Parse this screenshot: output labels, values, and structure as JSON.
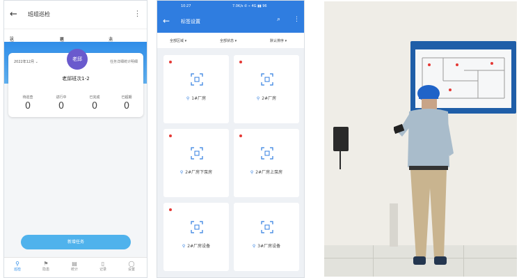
{
  "phone1": {
    "back_glyph": "←",
    "title": "班组巡检",
    "more_glyph": "⋮",
    "menu": [
      {
        "icon": "list-icon",
        "glyph": "☷",
        "label": "巡检地址"
      },
      {
        "icon": "calendar-icon",
        "glyph": "▦",
        "label": "巡检任务"
      },
      {
        "icon": "bell-icon",
        "glyph": "♫",
        "label": "消息提醒"
      }
    ],
    "card": {
      "avatar": "老邱",
      "date": "2022年12月 ⌄",
      "right_text": "任务详细统计明细",
      "team": "老邱班次1-2",
      "stats": [
        {
          "label": "待巡查",
          "value": "0"
        },
        {
          "label": "进行中",
          "value": "0"
        },
        {
          "label": "已完成",
          "value": "0"
        },
        {
          "label": "已超期",
          "value": "0"
        }
      ]
    },
    "button": "新增任务",
    "tabs": [
      {
        "icon": "location-icon",
        "glyph": "⚲",
        "label": "巡检"
      },
      {
        "icon": "flag-icon",
        "glyph": "⚑",
        "label": "隐患"
      },
      {
        "icon": "chart-icon",
        "glyph": "▤",
        "label": "统计"
      },
      {
        "icon": "file-icon",
        "glyph": "▯",
        "label": "记录"
      },
      {
        "icon": "user-icon",
        "glyph": "◯",
        "label": "设置"
      }
    ]
  },
  "phone2": {
    "status_left": "10:27",
    "status_right": "7.0K/s ✆ ⌁ 4G ▮▮ 96",
    "back_glyph": "←",
    "title": "标签设置",
    "search_glyph": "⌕",
    "more_glyph": "⋮",
    "filters": [
      "全部区域 ▾",
      "全部状态 ▾",
      "默认排序 ▾"
    ],
    "cards": [
      {
        "location": "1#厂房"
      },
      {
        "location": "2#厂房"
      },
      {
        "location": "2#厂房下泵房"
      },
      {
        "location": "2#厂房上泵房"
      },
      {
        "location": "2#厂房设备"
      },
      {
        "location": "3#厂房设备"
      }
    ]
  },
  "photo": {
    "description_colors": {
      "helmet": "#1f63c8",
      "shirt": "#a9bccb",
      "trousers": "#c9b48f",
      "board": "#1f5ea8"
    }
  }
}
